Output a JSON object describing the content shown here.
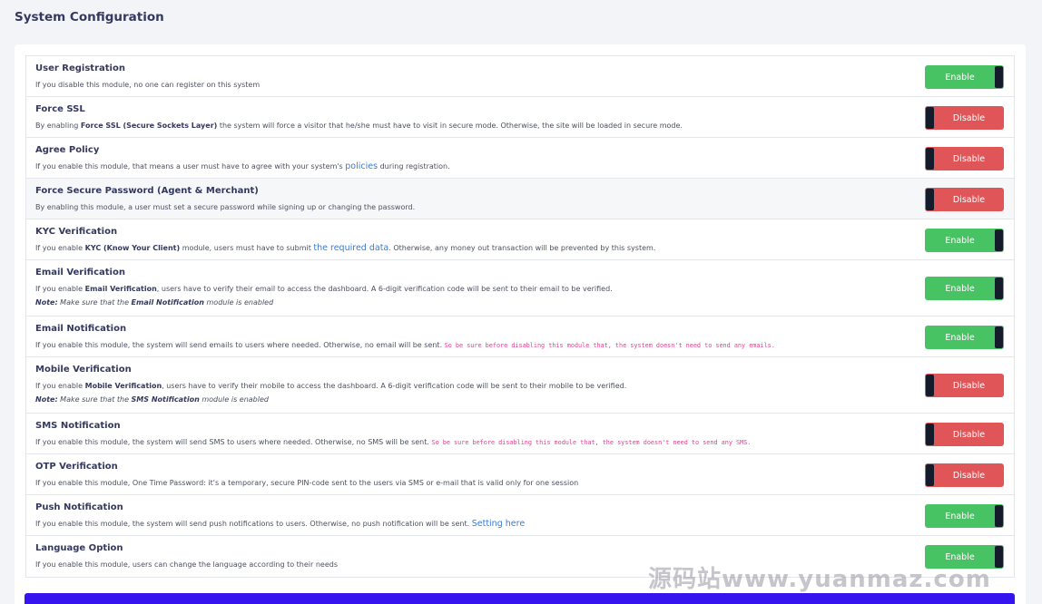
{
  "page": {
    "title": "System Configuration"
  },
  "modules": [
    {
      "title": "User Registration",
      "desc": [
        {
          "t": "If you disable this module, no one can register on this system"
        }
      ],
      "status": "Enable"
    },
    {
      "title": "Force SSL",
      "desc": [
        {
          "t": "By enabling "
        },
        {
          "t": "Force SSL (Secure Sockets Layer)",
          "s": "b"
        },
        {
          "t": " the system will force a visitor that he/she must have to visit in secure mode. Otherwise, the site will be loaded in secure mode."
        }
      ],
      "status": "Disable"
    },
    {
      "title": "Agree Policy",
      "desc": [
        {
          "t": "If you enable this module, that means a user must have to agree with your system's "
        },
        {
          "t": "policies",
          "s": "a"
        },
        {
          "t": " during registration."
        }
      ],
      "status": "Disable"
    },
    {
      "title": "Force Secure Password (Agent & Merchant)",
      "desc": [
        {
          "t": "By enabling this module, a user must set a secure password while signing up or changing the password."
        }
      ],
      "status": "Disable"
    },
    {
      "title": "KYC Verification",
      "desc": [
        {
          "t": "If you enable "
        },
        {
          "t": "KYC (Know Your Client)",
          "s": "b"
        },
        {
          "t": " module, users must have to submit "
        },
        {
          "t": "the required data",
          "s": "a"
        },
        {
          "t": ". Otherwise, any money out transaction will be prevented by this system."
        }
      ],
      "status": "Enable"
    },
    {
      "title": "Email Verification",
      "desc": [
        {
          "t": "If you enable "
        },
        {
          "t": "Email Verification",
          "s": "b"
        },
        {
          "t": ", users have to verify their email to access the dashboard. A 6-digit verification code will be sent to their email to be verified."
        }
      ],
      "note": [
        {
          "t": "Note:",
          "s": "b"
        },
        {
          "t": " Make sure that the "
        },
        {
          "t": "Email Notification",
          "s": "b"
        },
        {
          "t": " module is enabled"
        }
      ],
      "status": "Enable"
    },
    {
      "title": "Email Notification",
      "desc": [
        {
          "t": "If you enable this module, the system will send emails to users where needed. Otherwise, no email will be sent. "
        },
        {
          "t": "So be sure before disabling this module that, the system doesn't need to send any emails.",
          "s": "code"
        }
      ],
      "status": "Enable"
    },
    {
      "title": "Mobile Verification",
      "desc": [
        {
          "t": "If you enable "
        },
        {
          "t": "Mobile Verification",
          "s": "b"
        },
        {
          "t": ", users have to verify their mobile to access the dashboard. A 6-digit verification code will be sent to their mobile to be verified."
        }
      ],
      "note": [
        {
          "t": "Note:",
          "s": "b"
        },
        {
          "t": " Make sure that the "
        },
        {
          "t": "SMS Notification",
          "s": "b"
        },
        {
          "t": " module is enabled"
        }
      ],
      "status": "Disable"
    },
    {
      "title": "SMS Notification",
      "desc": [
        {
          "t": "If you enable this module, the system will send SMS to users where needed. Otherwise, no SMS will be sent. "
        },
        {
          "t": "So be sure before disabling this module that, the system doesn't need to send any SMS.",
          "s": "code"
        }
      ],
      "status": "Disable"
    },
    {
      "title": "OTP Verification",
      "desc": [
        {
          "t": "If you enable this module, One Time Password: it's a temporary, secure PIN-code sent to the users via SMS or e-mail that is valid only for one session"
        }
      ],
      "status": "Disable"
    },
    {
      "title": "Push Notification",
      "desc": [
        {
          "t": "If you enable this module, the system will send push notifications to users. Otherwise, no push notification will be sent. "
        },
        {
          "t": "Setting here",
          "s": "a"
        }
      ],
      "status": "Enable"
    },
    {
      "title": "Language Option",
      "desc": [
        {
          "t": "If you enable this module, users can change the language according to their needs"
        }
      ],
      "status": "Enable"
    }
  ],
  "watermark": "源码站www.yuanmaz.com",
  "colors": {
    "enable": "#47c363",
    "disable": "#e05558",
    "knob": "#141b2b",
    "link": "#3a7bd5",
    "code": "#e83e8c",
    "primary": "#3514f0"
  }
}
